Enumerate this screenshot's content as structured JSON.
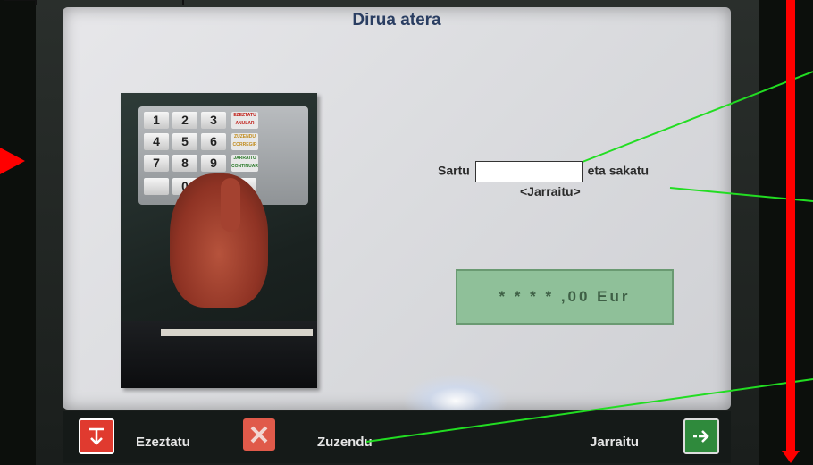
{
  "screen": {
    "title": "Dirua atera",
    "prompt": {
      "before": "Sartu",
      "after": "eta sakatu",
      "action": "<Jarraitu>"
    },
    "amount_display": "* * * * ,00   Eur"
  },
  "keypad": {
    "keys": [
      "1",
      "2",
      "3",
      "4",
      "5",
      "6",
      "7",
      "8",
      "9",
      "",
      "0",
      "0",
      ","
    ],
    "function_keys": [
      "EZEZTATU ANULAR",
      "ZUZENDU CORREGIR",
      "JARRAITU CONTINUAR"
    ]
  },
  "bottom_bar": {
    "cancel_label": "Ezeztatu",
    "correct_label": "Zuzendu",
    "continue_label": "Jarraitu"
  },
  "colors": {
    "cancel_button": "#e03a2f",
    "continue_button": "#2f8a3c",
    "annotation_red": "#ff0000",
    "annotation_green": "#22dd22",
    "amount_box": "#8fc099"
  }
}
